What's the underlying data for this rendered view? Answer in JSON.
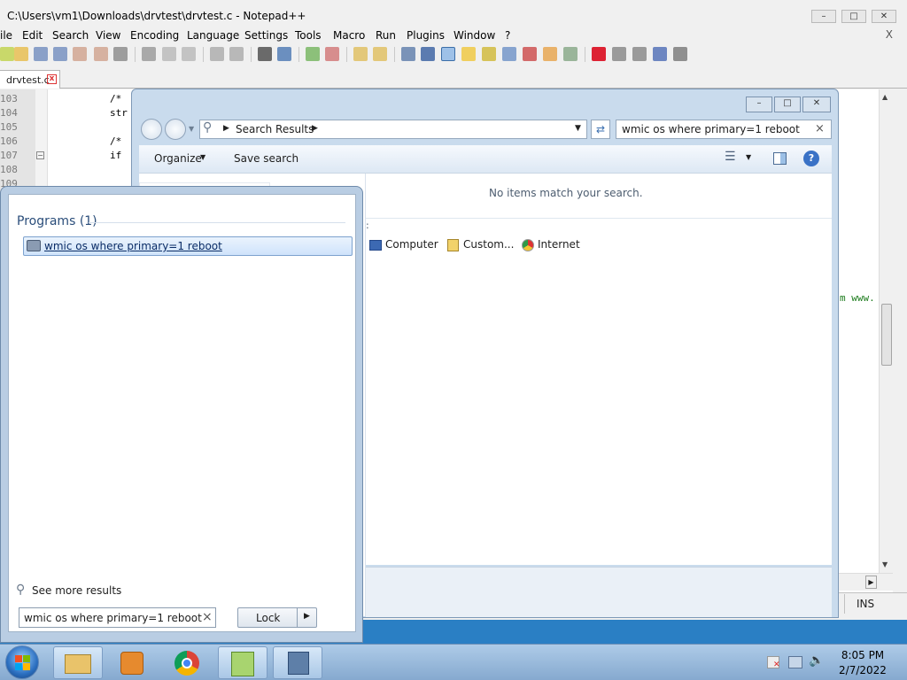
{
  "notepad": {
    "title": "C:\\Users\\vm1\\Downloads\\drvtest\\drvtest.c - Notepad++",
    "menu": [
      "ile",
      "Edit",
      "Search",
      "View",
      "Encoding",
      "Language",
      "Settings",
      "Tools",
      "Macro",
      "Run",
      "Plugins",
      "Window",
      "?"
    ],
    "close_doc": "X",
    "tab_label": "drvtest.c",
    "line_numbers": [
      "103",
      "104",
      "105",
      "106",
      "107",
      "108",
      "109"
    ],
    "code_lines": [
      "/*",
      "str",
      "",
      "/*",
      "if",
      "",
      ""
    ],
    "code_fragment_right": "m www.",
    "status_mode": "INS"
  },
  "explorer": {
    "address_label": "Search Results",
    "search_value": "wmic os where primary=1 reboot",
    "toolbar": {
      "organize": "Organize",
      "save_search": "Save search"
    },
    "empty_message": "No items match your search.",
    "search_again_suffix": ":",
    "locations": [
      "Computer",
      "Custom...",
      "Internet"
    ]
  },
  "start_menu": {
    "programs_header": "Programs (1)",
    "program_item": "wmic os where primary=1 reboot",
    "see_more": "See more results",
    "search_value": "wmic os where primary=1 reboot",
    "clear": "×",
    "lock_label": "Lock"
  },
  "taskbar": {
    "time": "8:05 PM",
    "date": "2/7/2022"
  }
}
